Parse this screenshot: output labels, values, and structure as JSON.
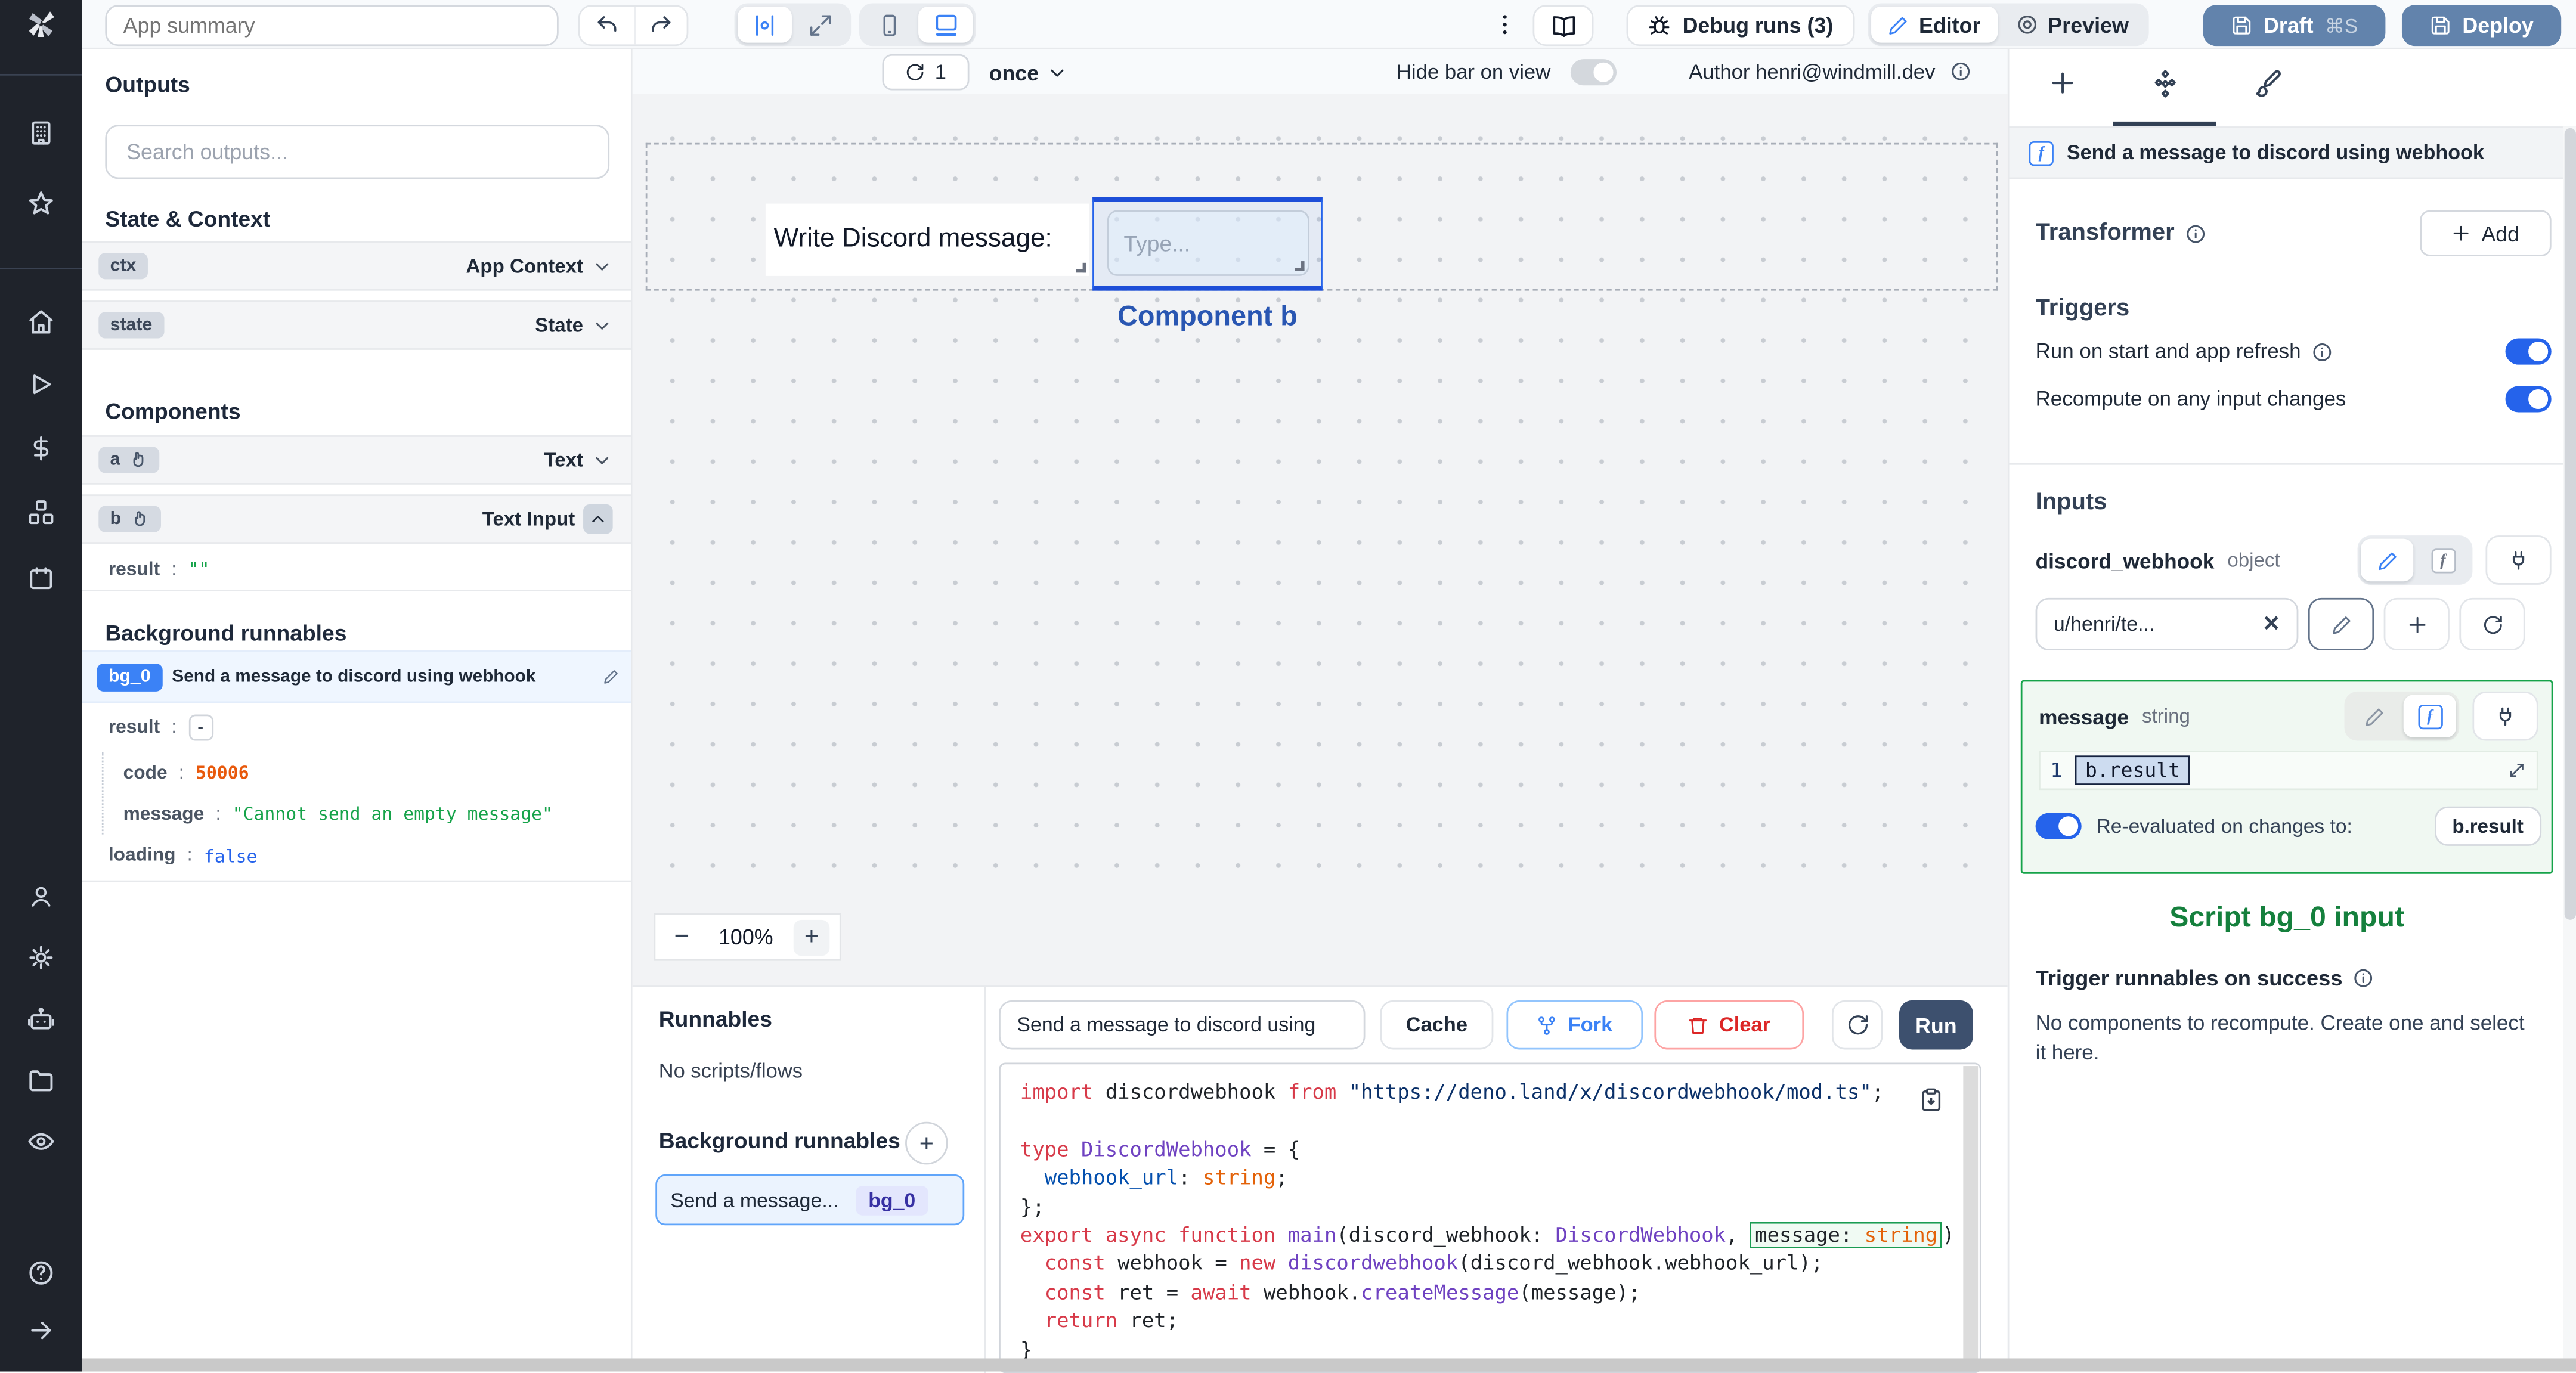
{
  "colors": {
    "accent": "#3b82f6",
    "slate_button": "#6283ac",
    "success_green": "#16a34a",
    "error_orange": "#e8590c",
    "boolean_blue": "#2563eb",
    "selection_blue": "#1d4ed8"
  },
  "topbar": {
    "app_summary_placeholder": "App summary",
    "debug_runs": "Debug runs (3)",
    "editor": "Editor",
    "preview": "Preview",
    "draft": "Draft",
    "draft_shortcut": "⌘S",
    "deploy": "Deploy"
  },
  "left": {
    "outputs_title": "Outputs",
    "search_placeholder": "Search outputs...",
    "state_context_title": "State & Context",
    "state_rows": [
      {
        "id": "ctx",
        "type": "App Context"
      },
      {
        "id": "state",
        "type": "State"
      }
    ],
    "components_title": "Components",
    "component_rows": [
      {
        "id": "a",
        "type": "Text"
      },
      {
        "id": "b",
        "type": "Text Input"
      }
    ],
    "b_result_key": "result",
    "b_result_value": "\"\"",
    "background_title": "Background runnables",
    "bg_badge": "bg_0",
    "bg_name": "Send a message to discord using webhook",
    "bg_result_key": "result",
    "bg_result_value": "-",
    "bg_code_key": "code",
    "bg_code_value": "50006",
    "bg_message_key": "message",
    "bg_message_value": "\"Cannot send an empty message\"",
    "bg_loading_key": "loading",
    "bg_loading_value": "false"
  },
  "canvas": {
    "refresh_count": "1",
    "mode": "once",
    "hide_bar": "Hide bar on view",
    "author": "Author henri@windmill.dev",
    "text_component": "Write Discord message:",
    "input_placeholder": "Type...",
    "selected_component_label": "Component b",
    "zoom_out": "−",
    "zoom_level": "100%",
    "zoom_in": "+"
  },
  "runnables": {
    "title": "Runnables",
    "empty": "No scripts/flows",
    "background_title": "Background runnables",
    "item_name": "Send a message...",
    "item_badge": "bg_0"
  },
  "code": {
    "name_value": "Send a message to discord using",
    "cache": "Cache",
    "fork": "Fork",
    "clear": "Clear",
    "run": "Run",
    "lines": [
      [
        [
          "k",
          "import"
        ],
        [
          "p",
          " discordwebhook "
        ],
        [
          "k",
          "from"
        ],
        [
          "s",
          " \"https://deno.land/x/discordwebhook/mod.ts\""
        ],
        [
          "p",
          ";"
        ]
      ],
      [],
      [
        [
          "k",
          "type"
        ],
        [
          "p",
          " "
        ],
        [
          "t",
          "DiscordWebhook"
        ],
        [
          "p",
          " = {"
        ]
      ],
      [
        [
          "p",
          "  "
        ],
        [
          "v",
          "webhook_url"
        ],
        [
          "p",
          ": "
        ],
        [
          "b",
          "string"
        ],
        [
          "p",
          ";"
        ]
      ],
      [
        [
          "p",
          "};"
        ]
      ],
      [
        [
          "k",
          "export"
        ],
        [
          "p",
          " "
        ],
        [
          "k",
          "async"
        ],
        [
          "p",
          " "
        ],
        [
          "k",
          "function"
        ],
        [
          "p",
          " "
        ],
        [
          "t",
          "main"
        ],
        [
          "p",
          "(discord_webhook: "
        ],
        [
          "t",
          "DiscordWebhook"
        ],
        [
          "p",
          ", "
        ],
        [
          "hl",
          [
            [
              "p",
              "message: "
            ],
            [
              "b",
              "string"
            ]
          ]
        ],
        [
          "p",
          ") {"
        ]
      ],
      [
        [
          "p",
          "  "
        ],
        [
          "k",
          "const"
        ],
        [
          "p",
          " webhook = "
        ],
        [
          "k",
          "new"
        ],
        [
          "p",
          " "
        ],
        [
          "t",
          "discordwebhook"
        ],
        [
          "p",
          "(discord_webhook.webhook_url);"
        ]
      ],
      [
        [
          "p",
          "  "
        ],
        [
          "k",
          "const"
        ],
        [
          "p",
          " ret = "
        ],
        [
          "k",
          "await"
        ],
        [
          "p",
          " webhook."
        ],
        [
          "t",
          "createMessage"
        ],
        [
          "p",
          "(message);"
        ]
      ],
      [
        [
          "p",
          "  "
        ],
        [
          "k",
          "return"
        ],
        [
          "p",
          " ret;"
        ]
      ],
      [
        [
          "p",
          "}"
        ]
      ]
    ]
  },
  "right": {
    "header": "Send a message to discord using webhook",
    "transformer_title": "Transformer",
    "add": "Add",
    "triggers_title": "Triggers",
    "trigger_run_on_start": "Run on start and app refresh",
    "trigger_recompute": "Recompute on any input changes",
    "inputs_title": "Inputs",
    "discord_webhook": {
      "name": "discord_webhook",
      "type": "object",
      "value": "u/henri/te..."
    },
    "message_input": {
      "name": "message",
      "type": "string",
      "line_number": "1",
      "expression": "b.result",
      "reeval_label": "Re-evaluated on changes to:",
      "reeval_target": "b.result"
    },
    "script_input_caption": "Script bg_0 input",
    "trigger_success_title": "Trigger runnables on success",
    "no_components_text": "No components to recompute. Create one and select it here."
  }
}
